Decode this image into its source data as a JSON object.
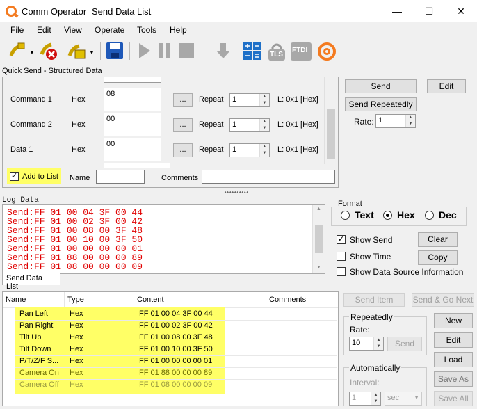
{
  "window": {
    "app_name": "Comm Operator",
    "doc_name": "Send Data List",
    "minimize": "—",
    "maximize": "☐",
    "close": "✕"
  },
  "menu": [
    "File",
    "Edit",
    "View",
    "Operate",
    "Tools",
    "Help"
  ],
  "toolbar": {
    "tls_label": "TLS",
    "ftdi_label": "FTDI"
  },
  "quick_send": {
    "header": "Quick Send - Structured Data",
    "rows": [
      {
        "label": "Command 1",
        "type": "Hex",
        "value": "08",
        "dots": "...",
        "repeat_label": "Repeat",
        "repeat": "1",
        "length": "L:  0x1 [Hex]"
      },
      {
        "label": "Command 2",
        "type": "Hex",
        "value": "00",
        "dots": "...",
        "repeat_label": "Repeat",
        "repeat": "1",
        "length": "L:  0x1 [Hex]"
      },
      {
        "label": "Data 1",
        "type": "Hex",
        "value": "00",
        "dots": "...",
        "repeat_label": "Repeat",
        "repeat": "1",
        "length": "L:  0x1 [Hex]"
      }
    ],
    "add_to_list_label": "Add to List",
    "add_to_list_checked": true,
    "name_label": "Name",
    "comments_label": "Comments",
    "send_button": "Send",
    "edit_button": "Edit",
    "send_repeatedly_button": "Send Repeatedly",
    "rate_label": "Rate:",
    "rate_value": "1"
  },
  "log": {
    "header": "Log Data",
    "lines": [
      "Send:FF 01 00 04 3F 00 44",
      "Send:FF 01 00 02 3F 00 42",
      "Send:FF 01 00 08 00 3F 48",
      "Send:FF 01 00 10 00 3F 50",
      "Send:FF 01 00 00 00 00 01",
      "Send:FF 01 88 00 00 00 89",
      "Send:FF 01 08 00 00 00 09"
    ],
    "color": "#e00000"
  },
  "format": {
    "title": "Format",
    "options": [
      "Text",
      "Hex",
      "Dec"
    ],
    "selected": "Hex",
    "show_send_label": "Show Send",
    "show_send_checked": true,
    "show_time_label": "Show Time",
    "show_time_checked": false,
    "show_source_label": "Show Data Source Information",
    "show_source_checked": false,
    "clear_button": "Clear",
    "copy_button": "Copy"
  },
  "send_data_list": {
    "tab": "Send Data List",
    "columns": [
      "Name",
      "Type",
      "Content",
      "Comments"
    ],
    "rows": [
      {
        "name": "Pan Left",
        "type": "Hex",
        "content": "FF 01 00 04 3F 00 44",
        "comments": ""
      },
      {
        "name": "Pan Right",
        "type": "Hex",
        "content": "FF 01 00 02 3F 00 42",
        "comments": ""
      },
      {
        "name": "Tilt Up",
        "type": "Hex",
        "content": "FF 01 00 08 00 3F 48",
        "comments": ""
      },
      {
        "name": "Tilt Down",
        "type": "Hex",
        "content": "FF 01 00 10 00 3F 50",
        "comments": ""
      },
      {
        "name": "P/T/Z/F S...",
        "type": "Hex",
        "content": "FF 01 00 00 00 00 01",
        "comments": ""
      },
      {
        "name": "Camera On",
        "type": "Hex",
        "content": "FF 01 88 00 00 00 89",
        "comments": ""
      },
      {
        "name": "Camera Off",
        "type": "Hex",
        "content": "FF 01 08 00 00 00 09",
        "comments": ""
      }
    ],
    "highlight_color": "#ffff66",
    "send_item_button": "Send Item",
    "send_go_next_button": "Send & Go Next",
    "repeatedly_title": "Repeatedly",
    "rate_label": "Rate:",
    "rate_value": "10",
    "send_button": "Send",
    "automatically_title": "Automatically",
    "interval_label": "Interval:",
    "interval_value": "1",
    "interval_unit": "sec",
    "new_button": "New",
    "edit_button": "Edit",
    "load_button": "Load",
    "save_as_button": "Save As",
    "save_all_button": "Save All"
  }
}
